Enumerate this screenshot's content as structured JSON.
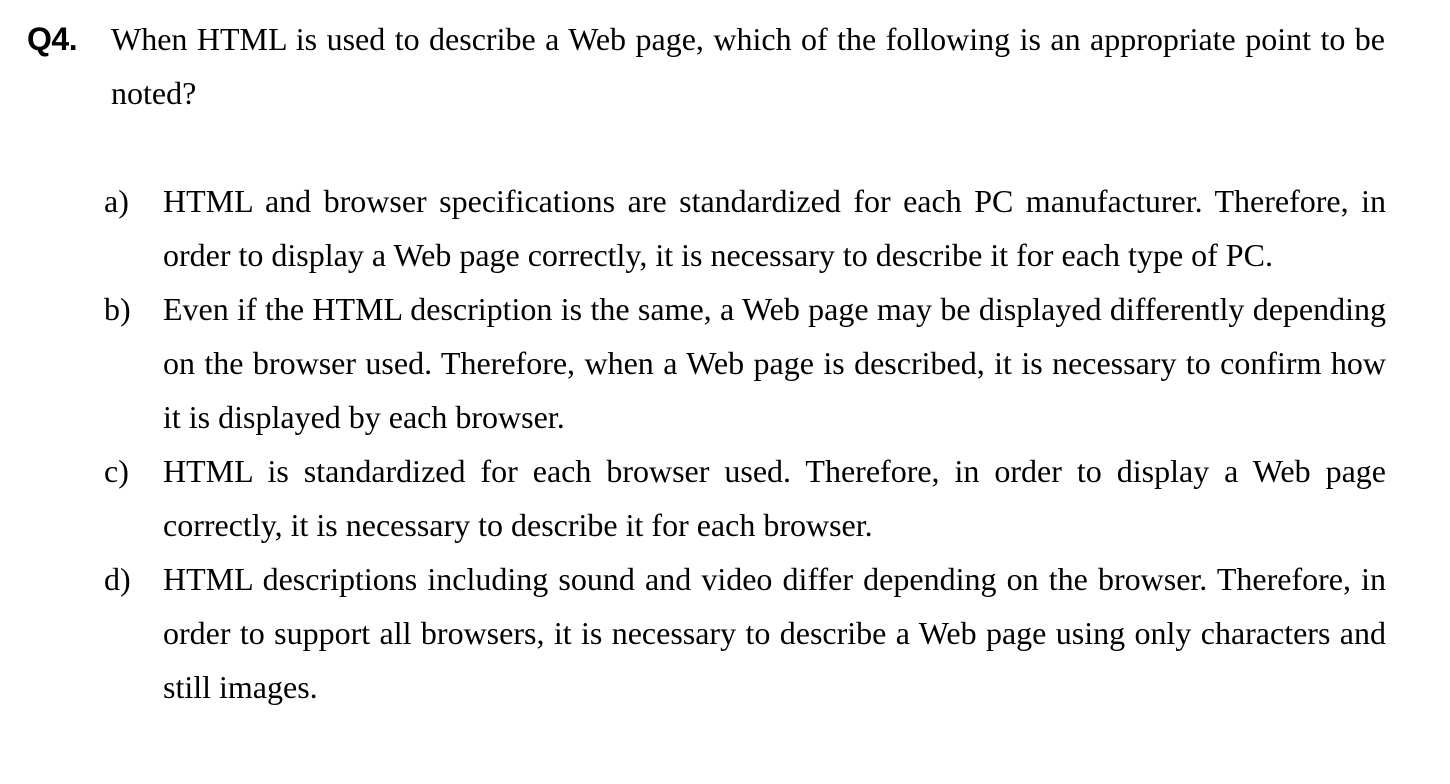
{
  "question": {
    "number": "Q4.",
    "text": "When HTML is used to describe a Web page, which of the following is an appropriate point to be noted?"
  },
  "options": [
    {
      "label": "a)",
      "text": "HTML and browser specifications are standardized for each PC manufacturer. Therefore, in order to display a Web page correctly, it is necessary to describe it for each type of PC."
    },
    {
      "label": "b)",
      "text": "Even if the HTML description is the same, a Web page may be displayed differently depending on the browser used.  Therefore, when a Web page is described, it is necessary to confirm how it is displayed by each browser."
    },
    {
      "label": "c)",
      "text": "HTML is standardized for each browser used.  Therefore, in order to display a Web page correctly, it is necessary to describe it for each browser."
    },
    {
      "label": "d)",
      "text": "HTML descriptions including sound and video differ depending on the browser. Therefore, in order to support all browsers, it is necessary to describe a Web page using only characters and still images."
    }
  ]
}
